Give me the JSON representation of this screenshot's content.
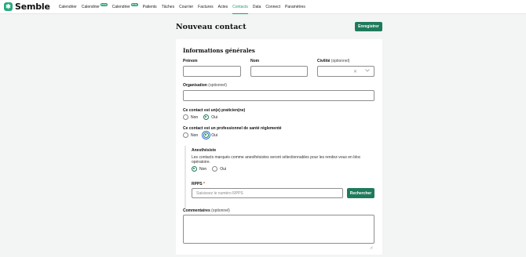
{
  "app": {
    "logo_text": "Semble",
    "logo_icon": "semble-logo-icon"
  },
  "nav": {
    "items": [
      {
        "label": "Calendrier",
        "badge": ""
      },
      {
        "label": "Calendrier",
        "badge": "beta"
      },
      {
        "label": "Calendrier",
        "badge": "beta"
      },
      {
        "label": "Patients",
        "badge": ""
      },
      {
        "label": "Tâches",
        "badge": ""
      },
      {
        "label": "Courrier",
        "badge": ""
      },
      {
        "label": "Factures",
        "badge": ""
      },
      {
        "label": "Actes",
        "badge": ""
      },
      {
        "label": "Contacts",
        "badge": "",
        "active": true
      },
      {
        "label": "Data",
        "badge": ""
      },
      {
        "label": "Connect",
        "badge": ""
      },
      {
        "label": "Paramètres",
        "badge": ""
      }
    ]
  },
  "header": {
    "title": "Nouveau contact",
    "save_label": "Enregistrer"
  },
  "form": {
    "section_title": "Informations générales",
    "prenom": {
      "label": "Prénom",
      "value": ""
    },
    "nom": {
      "label": "Nom",
      "value": ""
    },
    "civilite": {
      "label": "Civilité",
      "optional": "(optionnel)",
      "value": ""
    },
    "organisation": {
      "label": "Organisation",
      "optional": "(optionnel)",
      "value": ""
    },
    "praticien": {
      "label": "Ce contact est un(e) praticien(ne)",
      "options": [
        "Non",
        "Oui"
      ],
      "selected": "Oui"
    },
    "professionnel": {
      "label": "Ce contact est un professionnel de santé réglementé",
      "options": [
        "Non",
        "Oui"
      ],
      "selected": "Oui"
    },
    "anesthesiste": {
      "label": "Anesthésiste",
      "helper": "Les contacts marqués comme anesthésistes seront sélectionnables pour les rendez-vous en bloc opératoire.",
      "options": [
        "Non",
        "Oui"
      ],
      "selected": "Non"
    },
    "rpps": {
      "label": "RPPS",
      "required_mark": "*",
      "placeholder": "Saisissez le numéro RPPS",
      "search_label": "Rechercher"
    },
    "commentaires": {
      "label": "Commentaires",
      "optional": "(optionnel)",
      "value": ""
    }
  },
  "colors": {
    "accent": "#1f7a5c",
    "logo": "#2aa97f",
    "nav_active": "#1f9d73"
  }
}
